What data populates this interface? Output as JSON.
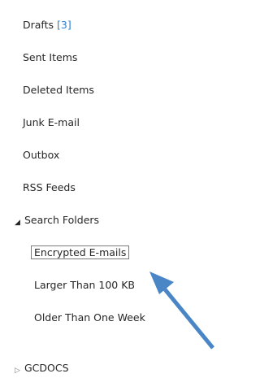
{
  "folders": {
    "drafts_label": "Drafts",
    "drafts_count": "[3]",
    "sent_items": "Sent Items",
    "deleted_items": "Deleted Items",
    "junk_email": "Junk E-mail",
    "outbox": "Outbox",
    "rss_feeds": "RSS Feeds",
    "search_folders": "Search Folders",
    "search_subfolders": [
      "Encrypted E-mails",
      "Larger Than 100 KB",
      "Older Than One Week"
    ],
    "gcdocs": "GCDOCS"
  },
  "icons": {
    "expanded": "expanded-triangle",
    "collapsed": "collapsed-triangle",
    "pointer": "blue-arrow"
  },
  "colors": {
    "count": "#2b7cd3",
    "arrow": "#4a86c5"
  }
}
